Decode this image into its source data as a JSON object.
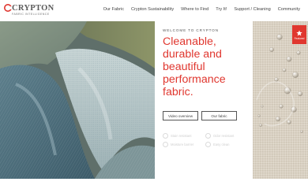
{
  "brand": {
    "name": "CRYPTON",
    "tagline": "FABRIC INTELLIGENCE",
    "accent": "#e0372f"
  },
  "nav": {
    "items": [
      {
        "label": "Our Fabric"
      },
      {
        "label": "Crypton Sustainability"
      },
      {
        "label": "Where to Find"
      },
      {
        "label": "Try It!"
      },
      {
        "label": "Support / Cleaning"
      },
      {
        "label": "Community"
      }
    ]
  },
  "hero": {
    "eyebrow": "WELCOME TO CRYPTON",
    "headline": "Cleanable, durable and beautiful performance fabric.",
    "buttons": {
      "video": "Video overview",
      "fabric": "Our fabric"
    },
    "features": [
      {
        "label": "Stain resistant",
        "icon": "drop-icon"
      },
      {
        "label": "Odor resistant",
        "icon": "leaf-icon"
      },
      {
        "label": "Moisture barrier",
        "icon": "shield-icon"
      },
      {
        "label": "Easy clean",
        "icon": "sparkle-icon"
      }
    ],
    "badge": {
      "label": "Featured",
      "icon": "star-icon"
    }
  }
}
